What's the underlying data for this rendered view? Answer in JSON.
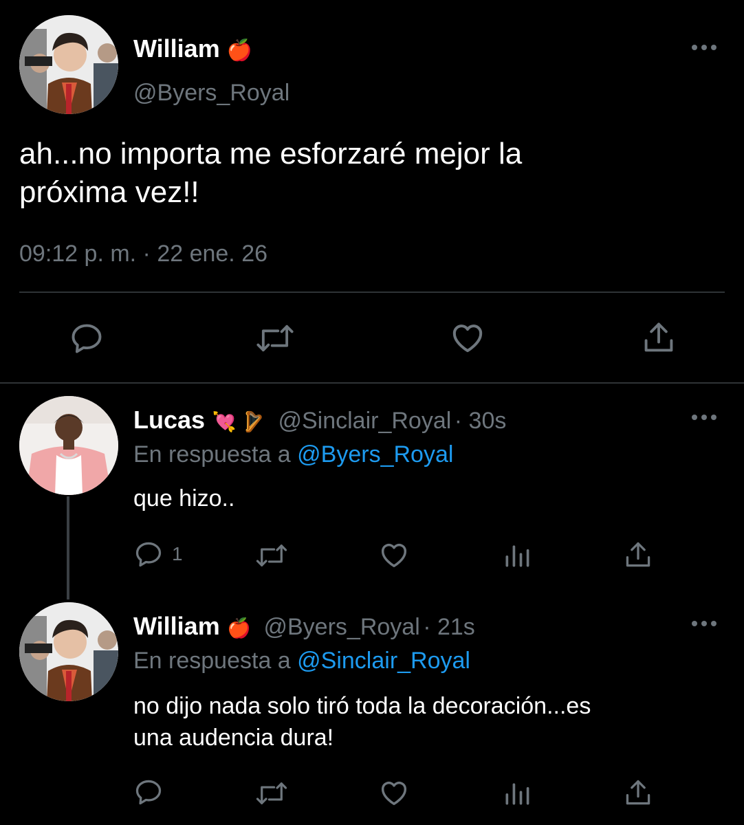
{
  "main_tweet": {
    "name": "William",
    "name_emoji": "🍎",
    "handle": "@Byers_Royal",
    "text_line1": "ah...no importa me esforzaré mejor la",
    "text_line2": "próxima vez!!",
    "timestamp": "09:12 p. m. · 22 ene. 26",
    "avatar_icon": "user-photo-william"
  },
  "replies": [
    {
      "name": "Lucas",
      "emojis": "💘 🪉",
      "handle": "@Sinclair_Royal",
      "time": "· 30s",
      "reply_prefix": "En respuesta a ",
      "reply_to": "@Byers_Royal",
      "text_line1": "que hizo..",
      "reply_count": "1"
    },
    {
      "name": "William",
      "emojis": "🍎",
      "handle": "@Byers_Royal",
      "time": "· 21s",
      "reply_prefix": "En respuesta a ",
      "reply_to": "@Sinclair_Royal",
      "text_line1": "no dijo nada solo tiró toda la decoración...es",
      "text_line2": "una audencia dura!",
      "reply_count": ""
    }
  ],
  "colors": {
    "background": "#000000",
    "muted": "#6e767d",
    "link": "#1d9bf0",
    "divider": "#2f3336"
  },
  "icons": [
    "reply-icon",
    "retweet-icon",
    "like-icon",
    "share-icon",
    "analytics-icon",
    "more-icon"
  ]
}
